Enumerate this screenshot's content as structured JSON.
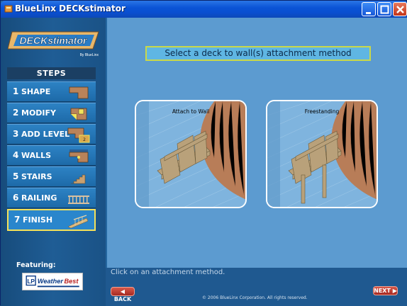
{
  "window": {
    "title": "BlueLinx DECKstimator"
  },
  "sidebar": {
    "logo_text": "DECKstimator",
    "logo_sub": "By BlueLinx",
    "steps_header": "STEPS",
    "steps": [
      {
        "num": "1",
        "label": "SHAPE",
        "icon": "shape-icon"
      },
      {
        "num": "2",
        "label": "MODIFY",
        "icon": "modify-icon"
      },
      {
        "num": "3",
        "label": "ADD LEVEL",
        "icon": "add-level-icon"
      },
      {
        "num": "4",
        "label": "WALLS",
        "icon": "walls-icon"
      },
      {
        "num": "5",
        "label": "STAIRS",
        "icon": "stairs-icon"
      },
      {
        "num": "6",
        "label": "RAILING",
        "icon": "railing-icon"
      },
      {
        "num": "7",
        "label": "FINISH",
        "icon": "finish-icon",
        "active": true
      }
    ],
    "featuring_label": "Featuring:",
    "sponsor_logo_text": "LP WeatherBest"
  },
  "main": {
    "instruction": "Select a deck to wall(s) attachment method",
    "options": [
      {
        "label": "Attach to Wall"
      },
      {
        "label": "Freestanding"
      }
    ],
    "hint": "Click on an attachment method."
  },
  "footer": {
    "back_label": "◀ BACK",
    "next_label": "NEXT ▶",
    "copyright": "© 2006 BlueLinx Corporation.  All rights reserved."
  },
  "colors": {
    "accent_yellow": "#f4e15a",
    "panel_blue": "#5c9bd0",
    "button_red": "#c3341a"
  }
}
